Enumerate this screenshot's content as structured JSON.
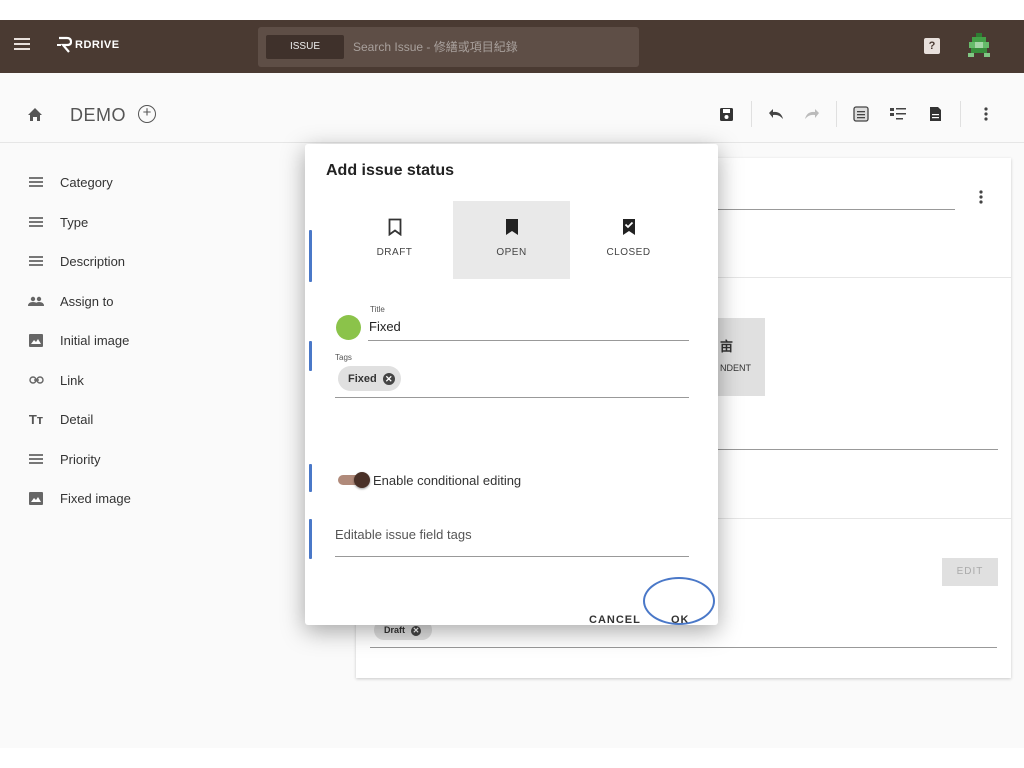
{
  "appbar": {
    "logo_text": "RDRIVE",
    "search_scope": "ISSUE",
    "search_placeholder": "Search Issue - 修繕或項目紀錄",
    "help_glyph": "?"
  },
  "toolbar": {
    "project_name": "DEMO",
    "icons": [
      "save-icon",
      "undo-icon",
      "redo-icon",
      "list-view-icon",
      "detail-view-icon",
      "document-icon",
      "more-vert-icon"
    ]
  },
  "sidebar": {
    "items": [
      {
        "label": "Category",
        "icon": "list-icon"
      },
      {
        "label": "Type",
        "icon": "list-icon"
      },
      {
        "label": "Description",
        "icon": "list-icon"
      },
      {
        "label": "Assign to",
        "icon": "people-icon"
      },
      {
        "label": "Initial image",
        "icon": "image-icon"
      },
      {
        "label": "Link",
        "icon": "link-icon"
      },
      {
        "label": "Detail",
        "icon": "text-icon"
      },
      {
        "label": "Priority",
        "icon": "list-icon"
      },
      {
        "label": "Fixed image",
        "icon": "image-icon"
      }
    ]
  },
  "background": {
    "frag_text": "NDENT",
    "edit_label": "EDIT",
    "draft_chip": "Draft"
  },
  "dialog": {
    "title": "Add issue status",
    "tabs": [
      {
        "label": "DRAFT",
        "icon": "bookmark-outline-icon",
        "selected": false
      },
      {
        "label": "OPEN",
        "icon": "bookmark-filled-icon",
        "selected": true
      },
      {
        "label": "CLOSED",
        "icon": "bookmark-check-icon",
        "selected": false
      }
    ],
    "color": "#8bc34a",
    "title_label": "Title",
    "title_value": "Fixed",
    "tags_label": "Tags",
    "tags": [
      "Fixed"
    ],
    "toggle_label": "Enable conditional editing",
    "toggle_on": true,
    "editable_tags_placeholder": "Editable issue field tags",
    "cancel_label": "CANCEL",
    "ok_label": "OK"
  },
  "colors": {
    "appbar": "#4a3a32",
    "accent_marker": "#4a78c8"
  }
}
